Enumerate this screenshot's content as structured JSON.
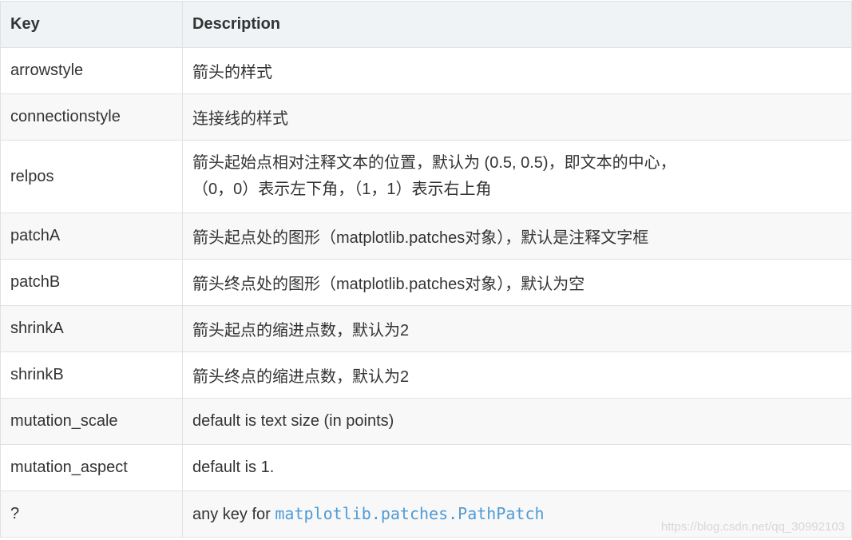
{
  "table": {
    "headers": [
      "Key",
      "Description"
    ],
    "rows": [
      {
        "key": "arrowstyle",
        "desc": [
          "箭头的样式"
        ]
      },
      {
        "key": "connectionstyle",
        "desc": [
          "连接线的样式"
        ]
      },
      {
        "key": "relpos",
        "desc": [
          "箭头起始点相对注释文本的位置，默认为 (0.5, 0.5)，即文本的中心，",
          "（0，0）表示左下角，（1，1）表示右上角"
        ]
      },
      {
        "key": "patchA",
        "desc": [
          "箭头起点处的图形（matplotlib.patches对象），默认是注释文字框"
        ]
      },
      {
        "key": "patchB",
        "desc": [
          "箭头终点处的图形（matplotlib.patches对象），默认为空"
        ]
      },
      {
        "key": "shrinkA",
        "desc": [
          "箭头起点的缩进点数，默认为2"
        ]
      },
      {
        "key": "shrinkB",
        "desc": [
          "箭头终点的缩进点数，默认为2"
        ]
      },
      {
        "key": "mutation_scale",
        "desc": [
          "default is text size (in points)"
        ]
      },
      {
        "key": "mutation_aspect",
        "desc": [
          "default is 1."
        ]
      },
      {
        "key": "?",
        "desc_prefix": "any key for ",
        "desc_code": "matplotlib.patches.PathPatch"
      }
    ]
  },
  "watermark": "https://blog.csdn.net/qq_30992103",
  "colors": {
    "header_bg": "#eff3f5",
    "stripe_bg": "#f8f8f8",
    "border": "#dfe2e5",
    "text": "#333333",
    "code": "#4f9bd6"
  }
}
